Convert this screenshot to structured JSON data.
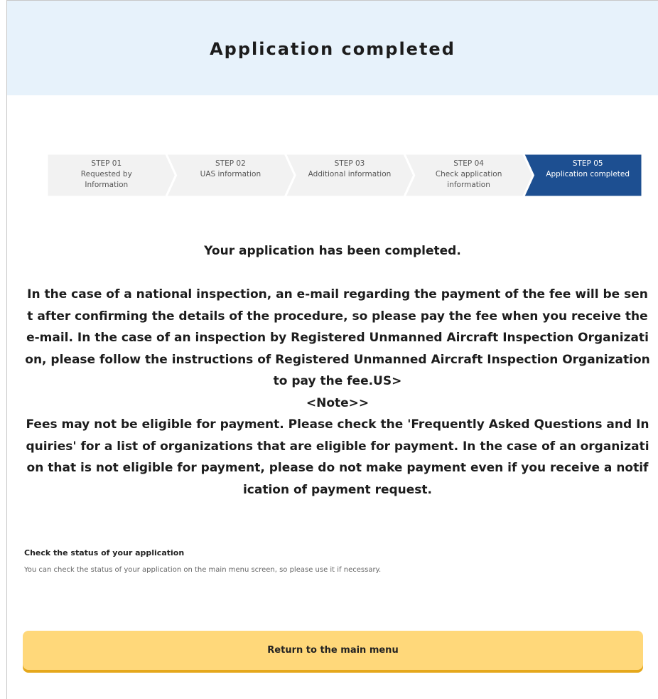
{
  "header": {
    "title": "Application completed"
  },
  "steps": [
    {
      "step": "STEP 01",
      "label": "Requested by Information",
      "active": false
    },
    {
      "step": "STEP 02",
      "label": "UAS information",
      "active": false
    },
    {
      "step": "STEP 03",
      "label": "Additional information",
      "active": false
    },
    {
      "step": "STEP 04",
      "label": "Check application information",
      "active": false
    },
    {
      "step": "STEP 05",
      "label": "Application completed",
      "active": true
    }
  ],
  "colors": {
    "header_bg": "#e7f2fb",
    "active_step": "#1d4f91",
    "step_bg": "#f2f2f2",
    "button_bg": "#ffd87a"
  },
  "message": {
    "title": "Your application has been completed.",
    "body": "In the case of a national inspection, an e-mail regarding the payment of the fee will be sent after confirming the details of the procedure, so please pay the fee when you receive the e-mail. In the case of an inspection by Registered Unmanned Aircraft Inspection Organization, please follow the instructions of Registered Unmanned Aircraft Inspection Organization to pay the fee.US>",
    "note_label": "<Note>>",
    "note": "Fees may not be eligible for payment. Please check the 'Frequently Asked Questions and Inquiries' for a list of organizations that are eligible for payment. In the case of an organization that is not eligible for payment, please do not make payment even if you receive a notification of payment request."
  },
  "status": {
    "heading": "Check the status of your application",
    "text": "You can check the status of your application on the main menu screen, so please use it if necessary."
  },
  "return_button": {
    "label": "Return to the main menu"
  }
}
